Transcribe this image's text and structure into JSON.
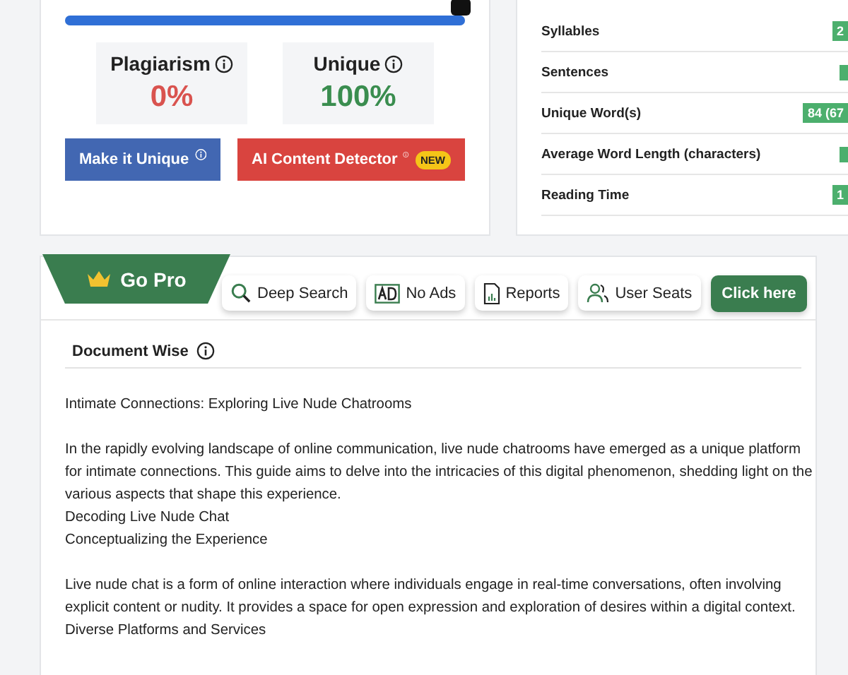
{
  "progress": {
    "level": 1
  },
  "scores": [
    {
      "label": "Plagiarism",
      "value": "0%",
      "kind": "bad"
    },
    {
      "label": "Unique",
      "value": "100%",
      "kind": "good"
    }
  ],
  "actions": [
    {
      "label": "Make it Unique",
      "kind": "primary"
    },
    {
      "label": "AI Content Detector",
      "kind": "danger",
      "badge": "NEW"
    }
  ],
  "stats": [
    {
      "label": "Syllables",
      "value": "2"
    },
    {
      "label": "Sentences"
    },
    {
      "label": "Unique Word(s)",
      "value": "84 (67"
    },
    {
      "label": "Average Word Length (characters)"
    },
    {
      "label": "Reading Time",
      "value": "1"
    }
  ],
  "pro": {
    "title": "Go Pro",
    "features": [
      {
        "label": "Deep Search",
        "kind": "search"
      },
      {
        "label": "No Ads",
        "kind": "ad"
      },
      {
        "label": "Reports",
        "kind": "report"
      },
      {
        "label": "User Seats",
        "kind": "users"
      }
    ],
    "cta": "Click here"
  },
  "section_title": "Document Wise",
  "document": [
    [
      "Intimate Connections: Exploring Live Nude Chatrooms"
    ],
    [
      "In the rapidly evolving landscape of online communication, live nude chatrooms have emerged as a unique platform for intimate connections. This guide aims to delve into the intricacies of this digital phenomenon, shedding light on the various aspects that shape this experience.",
      "Decoding Live Nude Chat",
      "Conceptualizing the Experience"
    ],
    [
      "Live nude chat is a form of online interaction where individuals engage in real-time conversations, often involving explicit content or nudity. It provides a space for open expression and exploration of desires within a digital context.",
      "Diverse Platforms and Services"
    ]
  ]
}
